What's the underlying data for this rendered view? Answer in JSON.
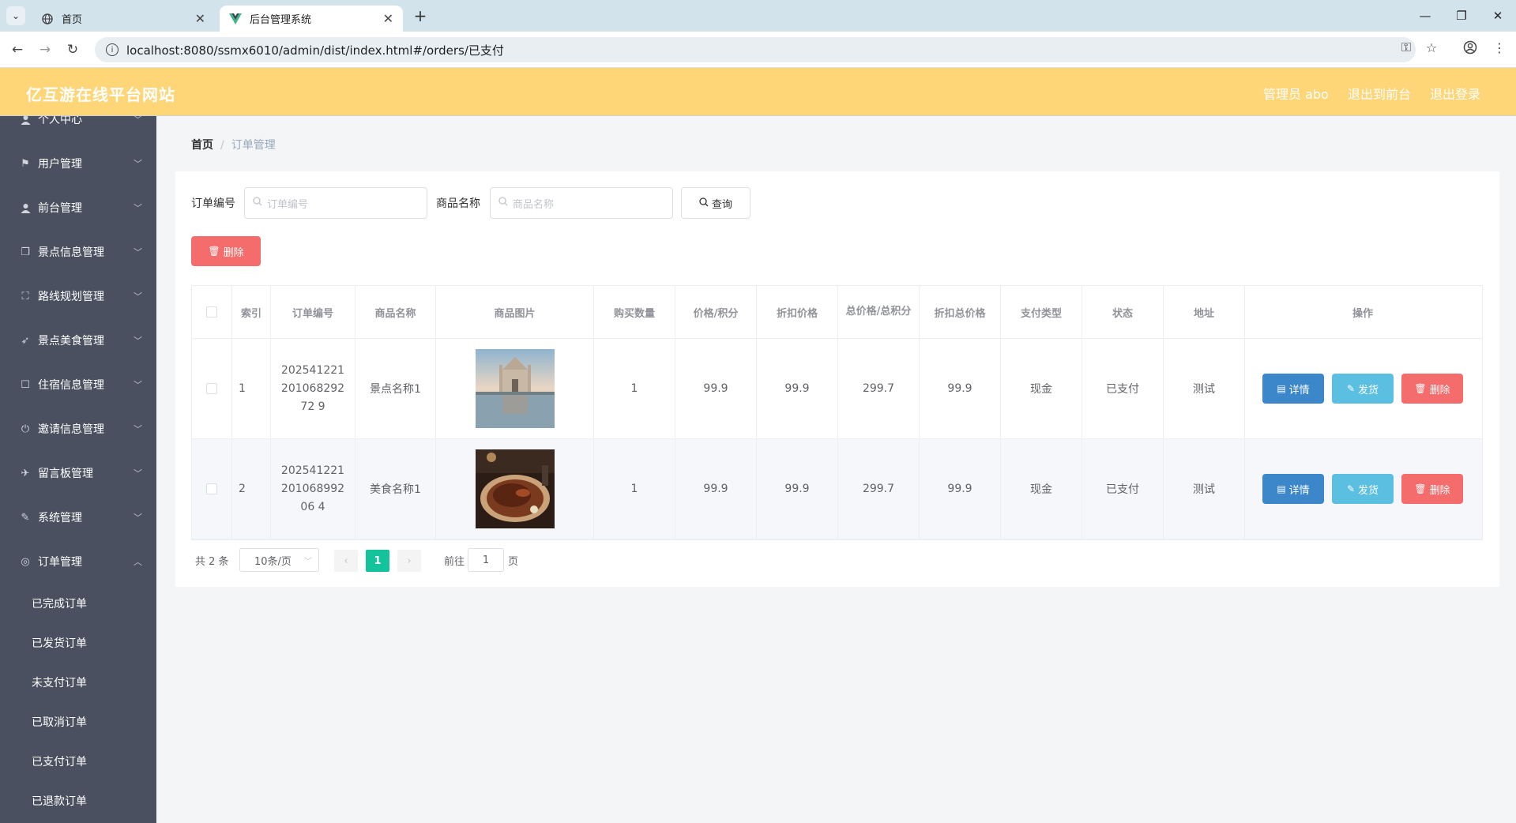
{
  "browser": {
    "tabs": [
      {
        "title": "首页",
        "active": false
      },
      {
        "title": "后台管理系统",
        "active": true
      }
    ],
    "url": "localhost:8080/ssmx6010/admin/dist/index.html#/orders/已支付"
  },
  "header": {
    "brand": "亿互游在线平台网站",
    "admin": "管理员 abo",
    "to_front": "退出到前台",
    "logout": "退出登录",
    "bg_color": "#ffd677"
  },
  "sidebar": {
    "items": [
      {
        "label": "个人中心",
        "icon": "user-icon"
      },
      {
        "label": "用户管理",
        "icon": "flag-icon"
      },
      {
        "label": "前台管理",
        "icon": "user-icon"
      },
      {
        "label": "景点信息管理",
        "icon": "copy-icon"
      },
      {
        "label": "路线规划管理",
        "icon": "fullscreen-icon"
      },
      {
        "label": "景点美食管理",
        "icon": "send-icon"
      },
      {
        "label": "住宿信息管理",
        "icon": "chat-icon"
      },
      {
        "label": "邀请信息管理",
        "icon": "power-icon"
      },
      {
        "label": "留言板管理",
        "icon": "paper-plane-icon"
      },
      {
        "label": "系统管理",
        "icon": "edit-off-icon"
      },
      {
        "label": "订单管理",
        "icon": "compass-icon"
      }
    ],
    "sub_items": [
      "已完成订单",
      "已发货订单",
      "未支付订单",
      "已取消订单",
      "已支付订单",
      "已退款订单"
    ]
  },
  "breadcrumb": {
    "home": "首页",
    "sep": "/",
    "current": "订单管理"
  },
  "search": {
    "order_no_label": "订单编号",
    "order_no_placeholder": "订单编号",
    "product_label": "商品名称",
    "product_placeholder": "商品名称",
    "query_label": "查询",
    "batch_delete_label": "删除"
  },
  "table": {
    "columns": [
      "索引",
      "订单编号",
      "商品名称",
      "商品图片",
      "购买数量",
      "价格/积分",
      "折扣价格",
      "总价格/总积分",
      "折扣总价格",
      "支付类型",
      "状态",
      "地址",
      "操作"
    ],
    "rows": [
      {
        "index": "1",
        "order_no": "20254122120106829272 9",
        "product": "景点名称1",
        "image": "scenic-photo",
        "qty": "1",
        "price": "99.9",
        "discount_price": "99.9",
        "total": "299.7",
        "discount_total": "99.9",
        "pay_type": "现金",
        "status": "已支付",
        "address": "测试"
      },
      {
        "index": "2",
        "order_no": "20254122120106899206 4",
        "product": "美食名称1",
        "image": "food-photo",
        "qty": "1",
        "price": "99.9",
        "discount_price": "99.9",
        "total": "299.7",
        "discount_total": "99.9",
        "pay_type": "现金",
        "status": "已支付",
        "address": "测试"
      }
    ],
    "actions": {
      "detail": "详情",
      "ship": "发货",
      "delete": "删除"
    }
  },
  "pagination": {
    "total": "共 2 条",
    "page_size": "10条/页",
    "current_page": "1",
    "goto_prefix": "前往",
    "goto_value": "1",
    "goto_suffix": "页",
    "active_color": "#13c39b"
  }
}
